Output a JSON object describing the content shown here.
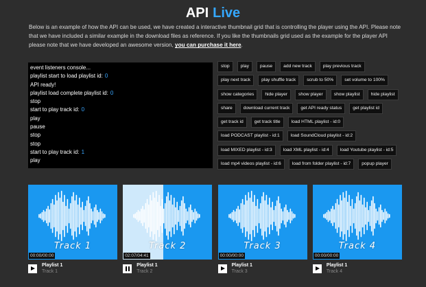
{
  "header": {
    "title": "API",
    "title_accent": "Live"
  },
  "intro": {
    "text": "Below is an example of how the API can be used, we have created a interactive thumbnail grid that is controlling the player using the API. Please note that we have included a similar example in the download files as reference. If you like the thumbnails grid used as the example for the player API please note that we have developed an awesome version,",
    "link": "you can purchase it here",
    "after": "."
  },
  "console": {
    "lines": [
      {
        "text": "event listeners console..."
      },
      {
        "text": "playlist start to load playlist id:",
        "num": "0"
      },
      {
        "text": "API ready!"
      },
      {
        "text": "playlist load complete playlist id:",
        "num": "0"
      },
      {
        "text": "stop"
      },
      {
        "text": "start to play track id:",
        "num": "0"
      },
      {
        "text": "play"
      },
      {
        "text": "pause"
      },
      {
        "text": "stop"
      },
      {
        "text": "stop"
      },
      {
        "text": "start to play track id:",
        "num": "1"
      },
      {
        "text": "play"
      }
    ]
  },
  "api_buttons": [
    [
      "stop",
      "play",
      "pause",
      "add new track",
      "play previous track"
    ],
    [
      "play next track",
      "play shuffle track",
      "scrub to 50%",
      "set volume to 100%"
    ],
    [
      "show categories",
      "hide player",
      "show player",
      "show playlist",
      "hide playlist"
    ],
    [
      "share",
      "download current track",
      "get API ready status",
      "get playlist id"
    ],
    [
      "get track id",
      "get track title",
      "load HTML playlist - id:0"
    ],
    [
      "load PODCAST playlist - id:1",
      "load SoundCloud playlist - id:2"
    ],
    [
      "load MIXED playlist - id:3",
      "load XML playlist - id:4",
      "load Youtube playlist - id:5"
    ],
    [
      "load mp4 videos playlist - id:6",
      "load from folder playlist - id:7",
      "popup player"
    ]
  ],
  "thumbnails": [
    {
      "label": "Track 1",
      "time": "00:00/00:00",
      "playlist": "Playlist 1",
      "track": "Track 1",
      "state": "play"
    },
    {
      "label": "Track 2",
      "time": "02:07/04:41",
      "playlist": "Playlist 1",
      "track": "Track 2",
      "state": "pause",
      "progress": 0.45
    },
    {
      "label": "Track 3",
      "time": "00:00/00:00",
      "playlist": "Playlist 1",
      "track": "Track 3",
      "state": "play"
    },
    {
      "label": "Track 4",
      "time": "00:00/00:00",
      "playlist": "Playlist 1",
      "track": "Track 4",
      "state": "play"
    }
  ],
  "colors": {
    "accent": "#35a8ff",
    "thumb_bg": "#1a98f0",
    "background": "#2d2d2d"
  }
}
